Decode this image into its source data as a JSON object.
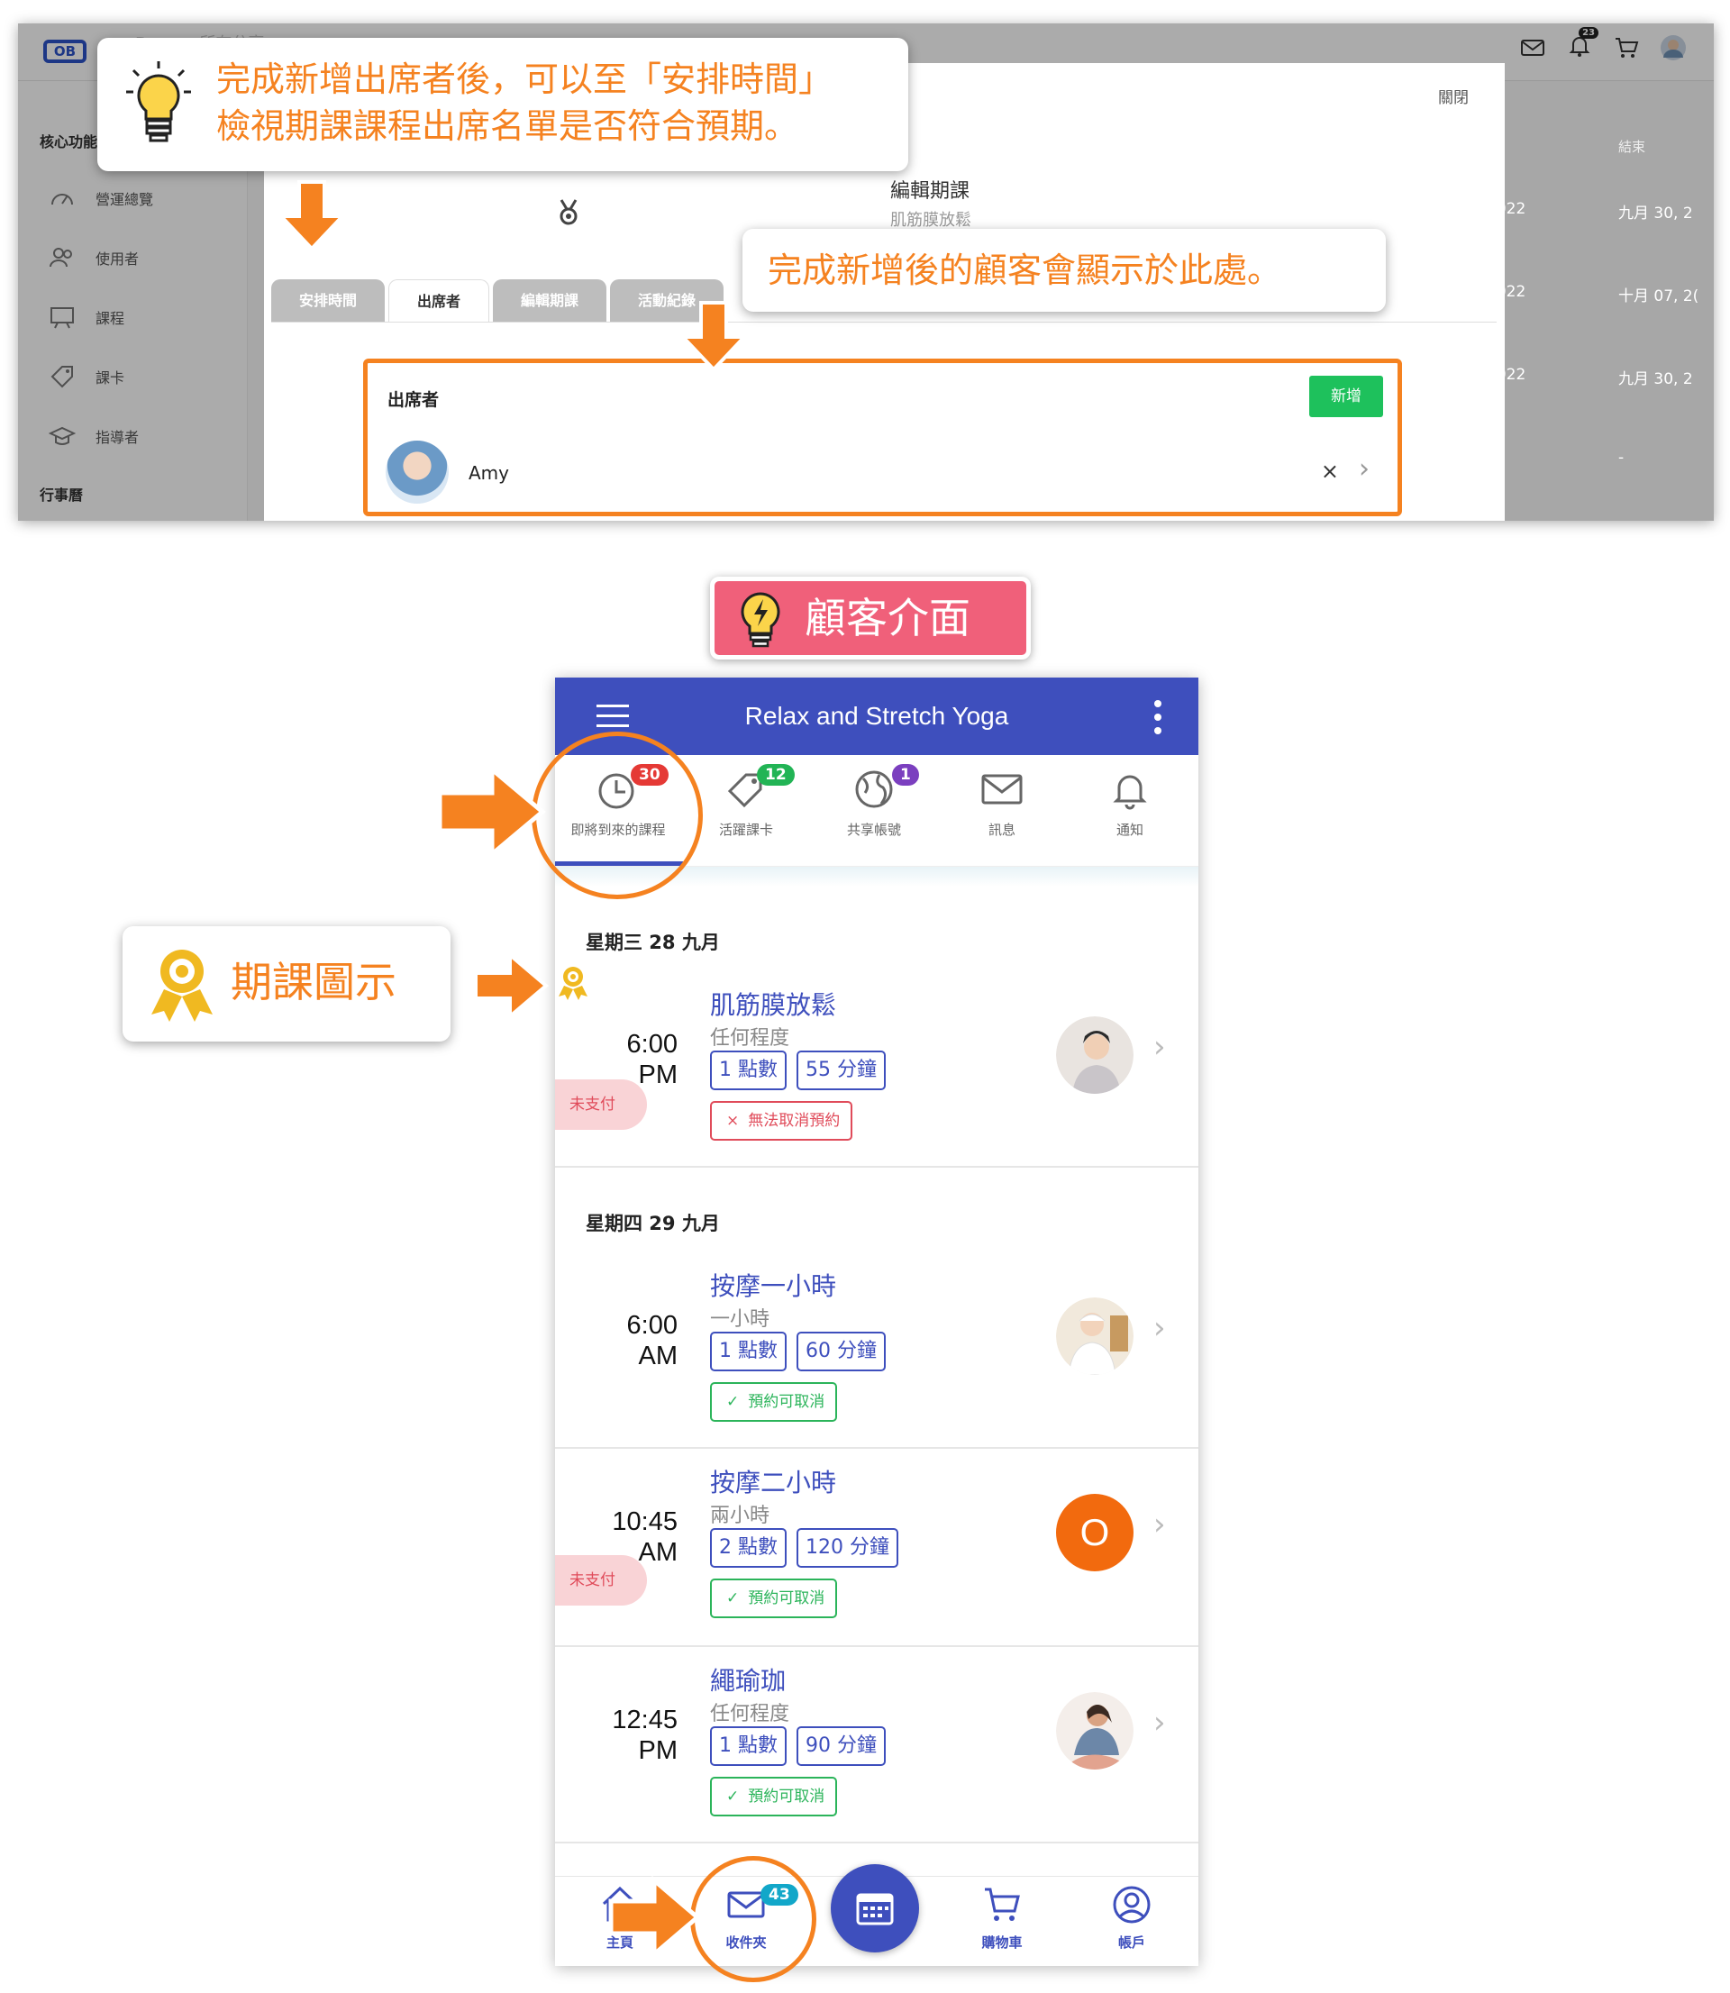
{
  "admin": {
    "demo_label": "Demo - 所有分享",
    "sidebar_head1": "核心功能",
    "sidebar_items": [
      "營運總覽",
      "使用者",
      "課程",
      "課卡",
      "指導者"
    ],
    "sidebar_head2": "行事曆",
    "top_badge": "23",
    "right_header": "結束",
    "right_rows": [
      {
        "a": "2022",
        "b": "九月 30, 2"
      },
      {
        "a": "2022",
        "b": "十月 07, 2("
      },
      {
        "a": "2022",
        "b": "九月 30, 2"
      },
      {
        "a": "",
        "b": "-"
      }
    ],
    "modal": {
      "close": "關閉",
      "title": "編輯期課",
      "subtitle": "肌筋膜放鬆",
      "tabs": [
        "安排時間",
        "出席者",
        "編輯期課",
        "活動紀錄"
      ],
      "attendees_label": "出席者",
      "add_button": "新增",
      "attendee_name": "Amy",
      "remove": "×",
      "chevron": "›"
    }
  },
  "callouts": {
    "top_line1": "完成新增出席者後，可以至「安排時間」",
    "top_line2": "檢視期課課程出席名單是否符合預期。",
    "attendee_note": "完成新增後的顧客會顯示於此處。",
    "section_title": "顧客介面",
    "series_icon_note": "期課圖示"
  },
  "phone": {
    "title": "Relax and Stretch Yoga",
    "tabs": [
      {
        "label": "即將到來的課程",
        "badge": "30",
        "badge_color": "#e53935"
      },
      {
        "label": "活躍課卡",
        "badge": "12",
        "badge_color": "#22b455"
      },
      {
        "label": "共享帳號",
        "badge": "1",
        "badge_color": "#7b3fbf"
      },
      {
        "label": "訊息",
        "badge": ""
      },
      {
        "label": "通知",
        "badge": ""
      }
    ],
    "days": [
      "星期三 28 九月",
      "星期四 29 九月"
    ],
    "lessons": [
      {
        "time1": "6:00",
        "time2": "PM",
        "title": "肌筋膜放鬆",
        "level": "任何程度",
        "points": "1 點數",
        "duration": "55 分鐘",
        "status": "無法取消預約",
        "status_mark": "×",
        "unpaid": "未支付"
      },
      {
        "time1": "6:00",
        "time2": "AM",
        "title": "按摩一小時",
        "level": "一小時",
        "points": "1 點數",
        "duration": "60 分鐘",
        "status": "預約可取消",
        "status_mark": "✓",
        "unpaid": ""
      },
      {
        "time1": "10:45",
        "time2": "AM",
        "title": "按摩二小時",
        "level": "兩小時",
        "points": "2 點數",
        "duration": "120 分鐘",
        "status": "預約可取消",
        "status_mark": "✓",
        "unpaid": "未支付",
        "avatar_letter": "O"
      },
      {
        "time1": "12:45",
        "time2": "PM",
        "title": "繩瑜珈",
        "level": "任何程度",
        "points": "1 點數",
        "duration": "90 分鐘",
        "status": "預約可取消",
        "status_mark": "✓",
        "unpaid": ""
      }
    ],
    "bottom": {
      "home": "主頁",
      "inbox": "收件夾",
      "inbox_badge": "43",
      "cart": "購物車",
      "account": "帳戶"
    }
  },
  "colors": {
    "primary": "#3e4fbd",
    "accent": "#f58220",
    "green": "#1ec15c",
    "red": "#e04b5a",
    "section_badge": "#f0607a"
  }
}
